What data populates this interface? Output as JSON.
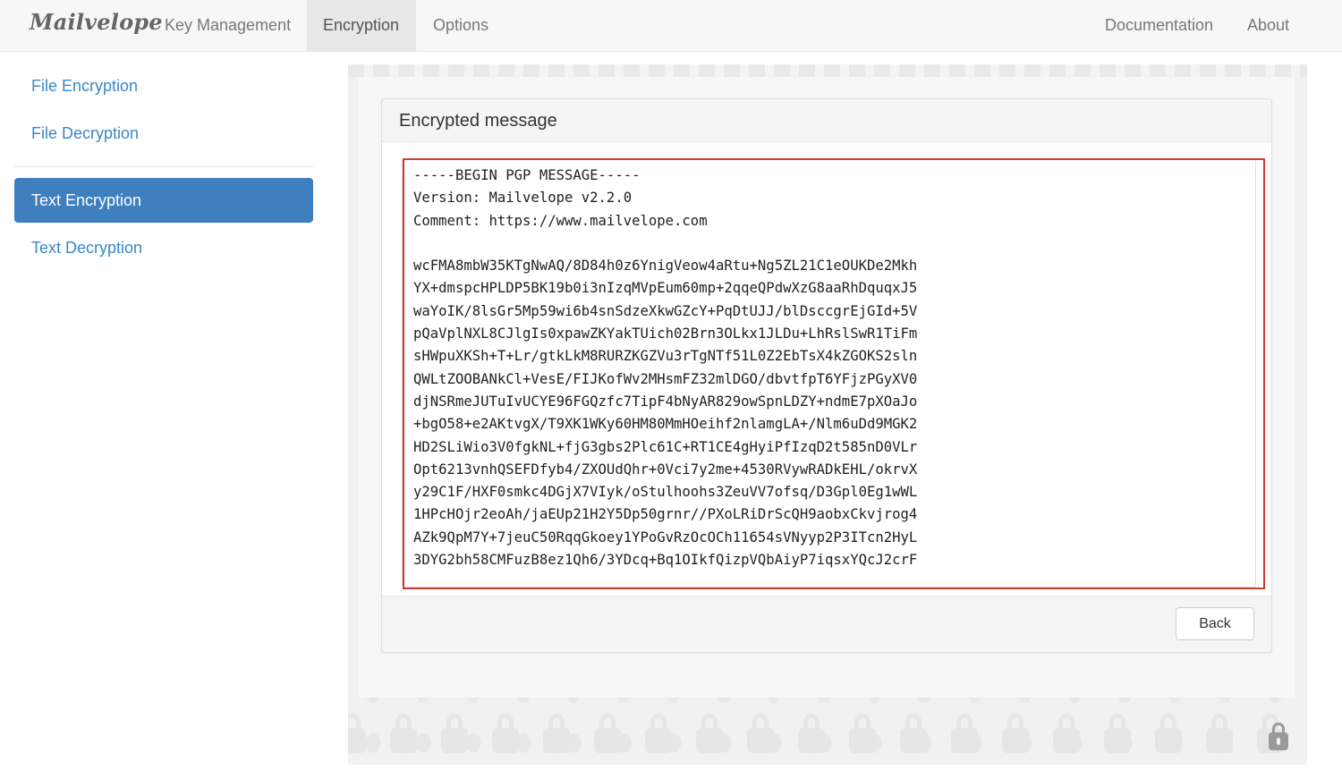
{
  "navbar": {
    "brand": "Mailvelope",
    "items": [
      {
        "label": "Key Management"
      },
      {
        "label": "Encryption"
      },
      {
        "label": "Options"
      }
    ],
    "right_items": [
      {
        "label": "Documentation"
      },
      {
        "label": "About"
      }
    ],
    "active": "Encryption"
  },
  "sidebar": {
    "items": [
      {
        "label": "File Encryption"
      },
      {
        "label": "File Decryption"
      },
      {
        "label": "Text Encryption"
      },
      {
        "label": "Text Decryption"
      }
    ],
    "active": "Text Encryption"
  },
  "card": {
    "title": "Encrypted message",
    "back_label": "Back"
  },
  "message": {
    "lines": [
      "-----BEGIN PGP MESSAGE-----",
      "Version: Mailvelope v2.2.0",
      "Comment: https://www.mailvelope.com",
      "",
      "wcFMA8mbW35KTgNwAQ/8D84h0z6YnigVeow4aRtu+Ng5ZL21C1eOUKDe2Mkh",
      "YX+dmspcHPLDP5BK19b0i3nIzqMVpEum60mp+2qqeQPdwXzG8aaRhDquqxJ5",
      "waYoIK/8lsGr5Mp59wi6b4snSdzeXkwGZcY+PqDtUJJ/blDsccgrEjGId+5V",
      "pQaVplNXL8CJlgIs0xpawZKYakTUich02Brn3OLkx1JLDu+LhRslSwR1TiFm",
      "sHWpuXKSh+T+Lr/gtkLkM8RURZKGZVu3rTgNTf51L0Z2EbTsX4kZGOKS2sln",
      "QWLtZOOBANkCl+VesE/FIJKofWv2MHsmFZ32mlDGO/dbvtfpT6YFjzPGyXV0",
      "djNSRmeJUTuIvUCYE96FGQzfc7TipF4bNyAR829owSpnLDZY+ndmE7pXOaJo",
      "+bgO58+e2AKtvgX/T9XK1WKy60HM80MmHOeihf2nlamgLA+/Nlm6uDd9MGK2",
      "HD2SLiWio3V0fgkNL+fjG3gbs2Plc61C+RT1CE4gHyiPfIzqD2t585nD0VLr",
      "Opt6213vnhQSEFDfyb4/ZXOUdQhr+0Vci7y2me+4530RVywRADkEHL/okrvX",
      "y29C1F/HXF0smkc4DGjX7VIyk/oStulhoohs3ZeuVV7ofsq/D3Gpl0Eg1wWL",
      "1HPcHOjr2eoAh/jaEUp21H2Y5Dp50grnr//PXoLRiDrScQH9aobxCkvjrog4",
      "AZk9QpM7Y+7jeuC50RqqGkoey1YPoGvRzOcOCh11654sVNyyp2P3ITcn2HyL",
      "3DYG2bh58CMFuzB8ez1Qh6/3YDcq+Bq1OIkfQizpVQbAiyP7iqsxYQcJ2crF"
    ]
  },
  "colors": {
    "accent": "#3e7fbf",
    "link": "#3a87c8",
    "highlight": "#d23b32"
  },
  "icons": {
    "corner": "lock-icon",
    "background_pattern": "lock-pattern"
  }
}
